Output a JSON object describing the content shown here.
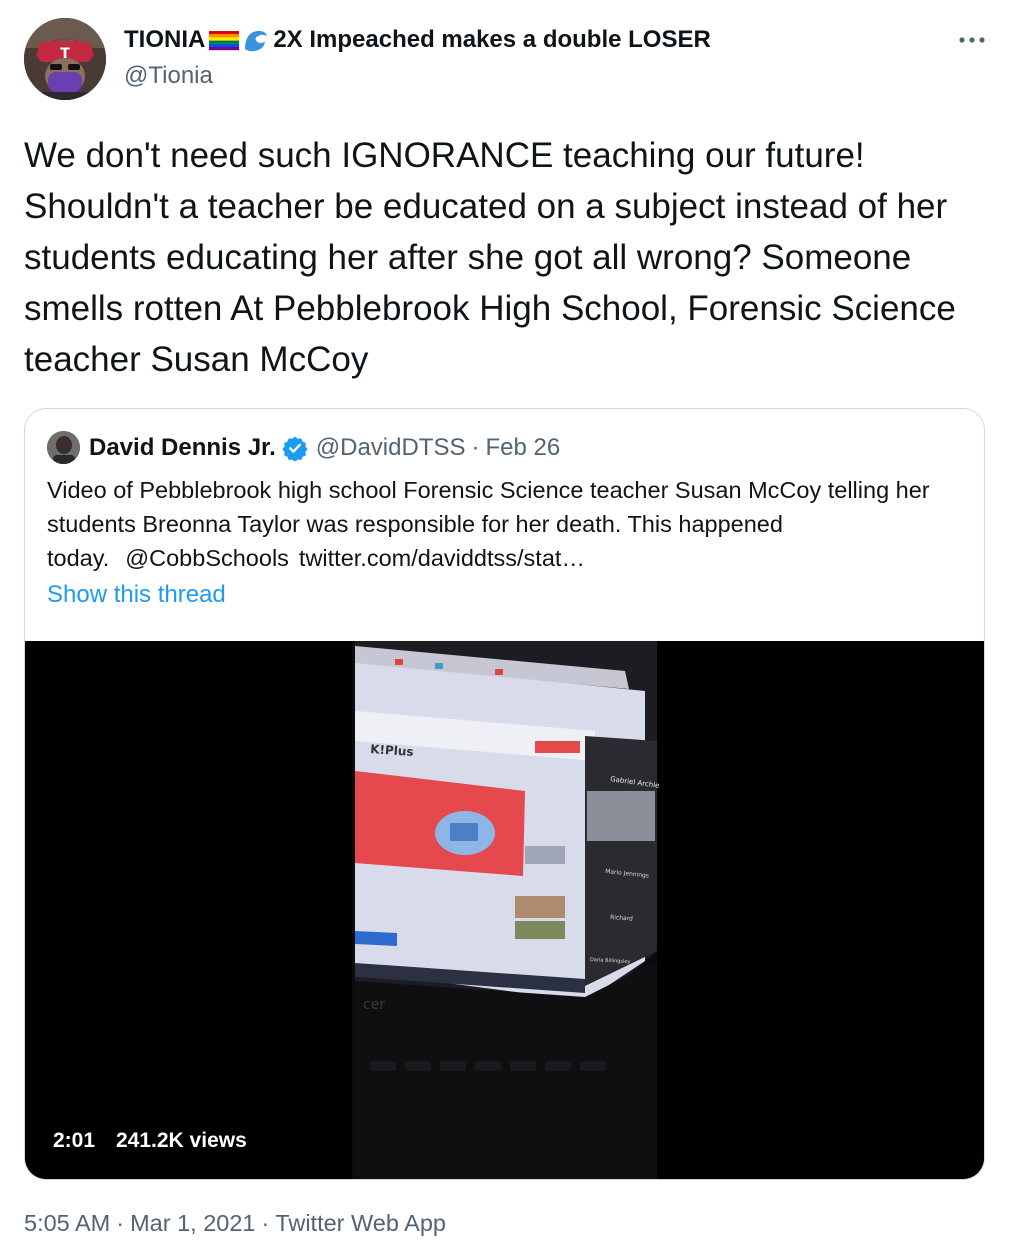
{
  "author": {
    "display_name": "TIONIA",
    "display_name_rest": "2X Impeached makes a double LOSER",
    "flag_icon": "rainbow-flag-icon",
    "wave_icon": "water-wave-icon",
    "handle": "@Tionia"
  },
  "tweet": {
    "text": "We don't need such IGNORANCE teaching our future! Shouldn't a teacher be educated on a subject instead of her students educating her after she got all wrong? Someone smells rotten At Pebblebrook High School, Forensic Science teacher Susan McCoy"
  },
  "quote": {
    "name": "David Dennis Jr.",
    "handle": "@DavidDTSS",
    "separator": "·",
    "date": "Feb 26",
    "text": "Video of Pebblebrook high school Forensic Science teacher Susan McCoy telling her students Breonna Taylor was responsible for her death. This happened today.",
    "mention": "@CobbSchools",
    "link": "twitter.com/daviddtss/stat…",
    "show_thread": "Show this thread",
    "video": {
      "duration": "2:01",
      "views": "241.2K views"
    }
  },
  "footer": {
    "time": "5:05 AM",
    "separator": "·",
    "date": "Mar 1, 2021",
    "source": "Twitter Web App"
  },
  "colors": {
    "accent": "#1d9bf0",
    "text_primary": "#0f1419",
    "text_secondary": "#536471",
    "border": "#cfd9de"
  }
}
